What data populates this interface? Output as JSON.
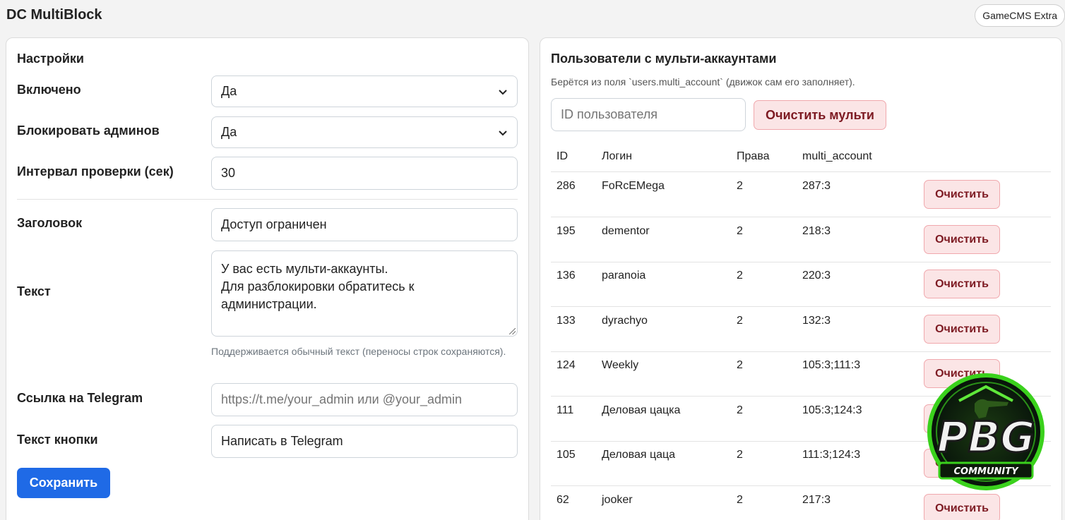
{
  "app": {
    "title": "DC MultiBlock",
    "badge": "GameCMS Extra"
  },
  "settings": {
    "title": "Настройки",
    "enabled": {
      "label": "Включено",
      "value": "Да"
    },
    "block_admins": {
      "label": "Блокировать админов",
      "value": "Да"
    },
    "interval": {
      "label": "Интервал проверки (сек)",
      "value": "30"
    },
    "heading": {
      "label": "Заголовок",
      "value": "Доступ ограничен"
    },
    "text": {
      "label": "Текст",
      "value": "У вас есть мульти-аккаунты.\nДля разблокировки обратитесь к администрации.",
      "hint": "Поддерживается обычный текст (переносы строк сохраняются)."
    },
    "telegram": {
      "label": "Ссылка на Telegram",
      "placeholder": "https://t.me/your_admin или @your_admin"
    },
    "button_text": {
      "label": "Текст кнопки",
      "value": "Написать в Telegram"
    },
    "save_label": "Сохранить"
  },
  "users": {
    "title": "Пользователи с мульти-аккаунтами",
    "subtitle": "Берётся из поля `users.multi_account` (движок сам его заполняет).",
    "search_placeholder": "ID пользователя",
    "clear_multi_label": "Очистить мульти",
    "columns": [
      "ID",
      "Логин",
      "Права",
      "multi_account"
    ],
    "clear_label": "Очистить",
    "rows": [
      {
        "id": "286",
        "login": "FoRcEMega",
        "rights": "2",
        "multi": "287:3"
      },
      {
        "id": "195",
        "login": "dementor",
        "rights": "2",
        "multi": "218:3"
      },
      {
        "id": "136",
        "login": "paranoia",
        "rights": "2",
        "multi": "220:3"
      },
      {
        "id": "133",
        "login": "dyrachyo",
        "rights": "2",
        "multi": "132:3"
      },
      {
        "id": "124",
        "login": "Weekly",
        "rights": "2",
        "multi": "105:3;111:3"
      },
      {
        "id": "111",
        "login": "Деловая цацка",
        "rights": "2",
        "multi": "105:3;124:3"
      },
      {
        "id": "105",
        "login": "Деловая цаца",
        "rights": "2",
        "multi": "111:3;124:3"
      },
      {
        "id": "62",
        "login": "jooker",
        "rights": "2",
        "multi": "217:3"
      }
    ]
  },
  "watermark": {
    "text": "PBG",
    "subtext": "COMMUNITY"
  },
  "colors": {
    "primary": "#1f6ae6",
    "danger_bg": "#fbe5e6",
    "danger_text": "#7d1a22",
    "logo_green": "#3ad11c"
  }
}
